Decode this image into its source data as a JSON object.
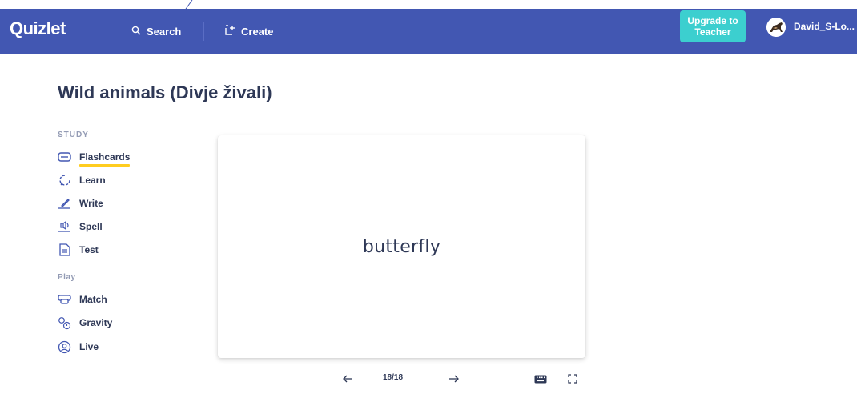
{
  "colors": {
    "navbar": "#4257b2",
    "upgrade": "#3ccfcf",
    "active_underline": "#ffcd1f",
    "text": "#2e3856",
    "muted": "#939bb4"
  },
  "nav": {
    "logo": "Quizlet",
    "search_label": "Search",
    "search_icon": "search-icon",
    "create_label": "Create",
    "create_icon": "create-set-icon",
    "upgrade_line1": "Upgrade to",
    "upgrade_line2": "Teacher",
    "username": "David_S-Lo..."
  },
  "set": {
    "title": "Wild animals (Divje živali)"
  },
  "sidebar": {
    "study_label": "STUDY",
    "study_items": [
      {
        "label": "Flashcards",
        "icon": "flashcards-icon",
        "active": true
      },
      {
        "label": "Learn",
        "icon": "learn-icon"
      },
      {
        "label": "Write",
        "icon": "write-icon"
      },
      {
        "label": "Spell",
        "icon": "spell-icon"
      },
      {
        "label": "Test",
        "icon": "test-icon"
      }
    ],
    "play_label": "Play",
    "play_items": [
      {
        "label": "Match",
        "icon": "match-icon"
      },
      {
        "label": "Gravity",
        "icon": "gravity-icon"
      },
      {
        "label": "Live",
        "icon": "live-icon"
      }
    ]
  },
  "card": {
    "term": "butterfly"
  },
  "controls": {
    "current": 18,
    "total": 18,
    "counter": "18/18",
    "prev_icon": "arrow-left-icon",
    "next_icon": "arrow-right-icon",
    "keyboard_icon": "keyboard-icon",
    "fullscreen_icon": "fullscreen-icon"
  }
}
